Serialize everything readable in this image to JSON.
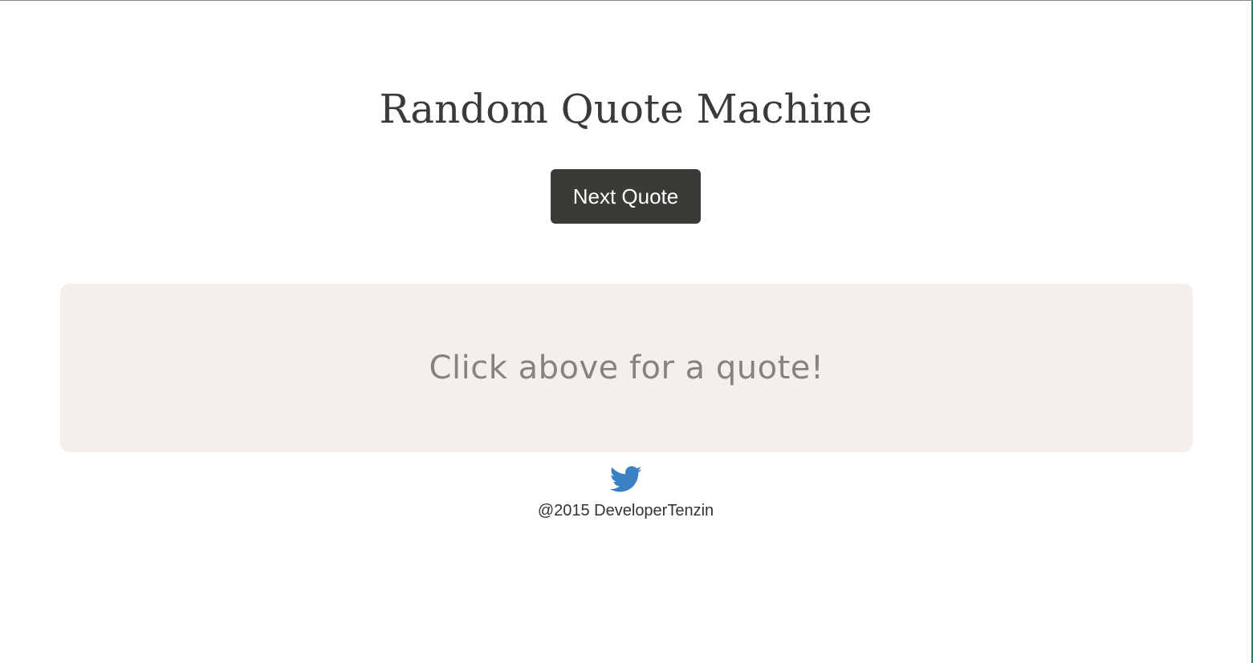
{
  "header": {
    "title": "Random Quote Machine"
  },
  "controls": {
    "next_label": "Next Quote"
  },
  "quote": {
    "text": "Click above for a quote!"
  },
  "social": {
    "icon": "twitter-icon",
    "icon_color": "#3b7fc4"
  },
  "footer": {
    "credit": "@2015 DeveloperTenzin"
  },
  "colors": {
    "button_bg": "#3b3a36",
    "quote_bg": "#f4efeb",
    "quote_text": "#858380",
    "title_text": "#3a3a3a"
  }
}
